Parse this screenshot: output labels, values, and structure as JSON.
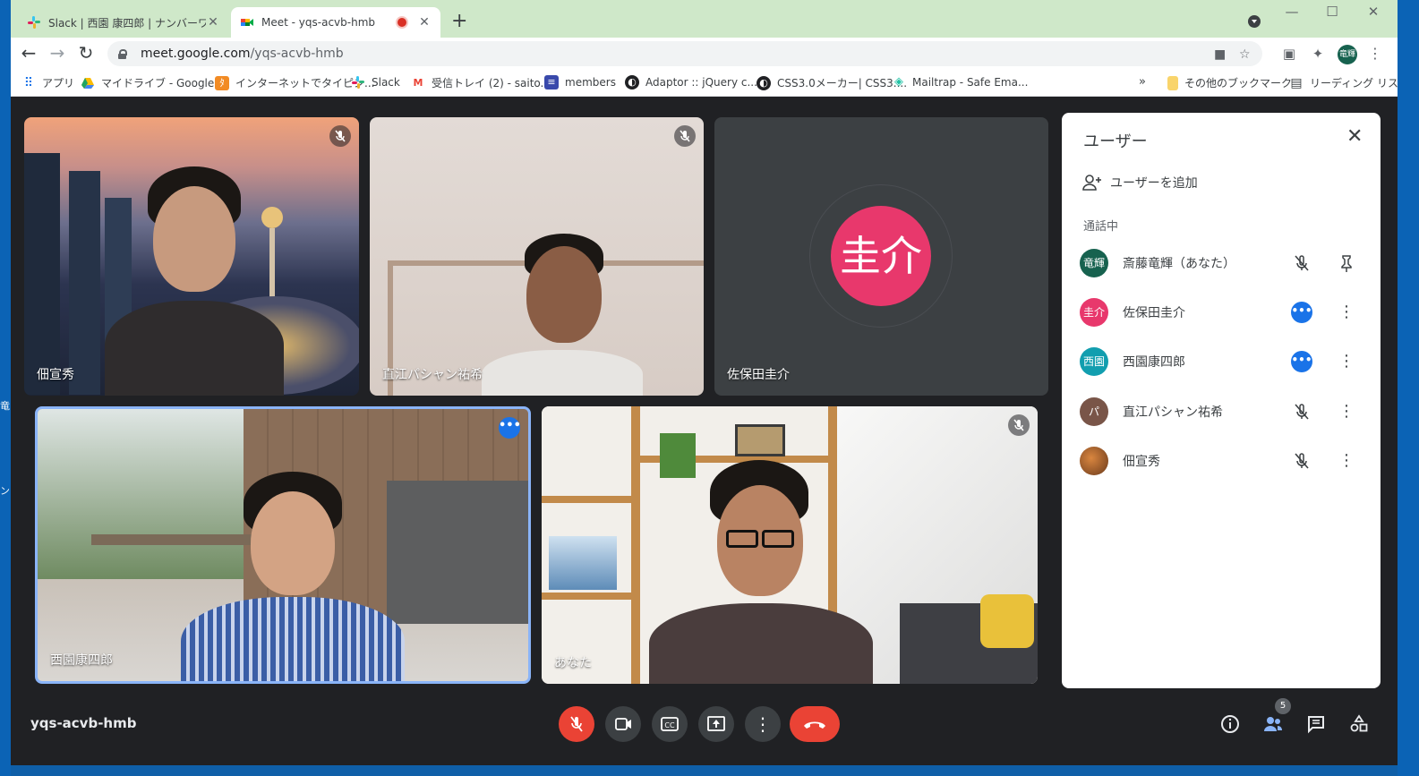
{
  "desktop": {
    "chars": [
      "竜",
      "ン"
    ]
  },
  "browser": {
    "tabs": [
      {
        "title": "Slack | 西園 康四郎 | ナンバーワンソ",
        "active": false
      },
      {
        "title": "Meet - yqs-acvb-hmb",
        "active": true
      }
    ],
    "new_tab": "+",
    "url_host": "meet.google.com",
    "url_path": "/yqs-acvb-hmb",
    "profile_initials": "竜輝",
    "bookmarks": [
      {
        "label": "アプリ",
        "icon": "apps-grid-icon"
      },
      {
        "label": "マイドライブ - Google...",
        "icon": "drive-icon"
      },
      {
        "label": "インターネットでタイピン...",
        "icon": "typing-icon"
      },
      {
        "label": "Slack",
        "icon": "slack-icon"
      },
      {
        "label": "受信トレイ (2) - saito...",
        "icon": "gmail-icon"
      },
      {
        "label": "members",
        "icon": "members-icon"
      },
      {
        "label": "Adaptor :: jQuery c...",
        "icon": "globe-icon"
      },
      {
        "label": "CSS3.0メーカー| CSS3....",
        "icon": "globe-icon"
      },
      {
        "label": "Mailtrap - Safe Ema...",
        "icon": "mailtrap-icon"
      }
    ],
    "bookmarks_more": "»",
    "other_bookmarks": "その他のブックマーク",
    "reading_list": "リーディング リスト"
  },
  "meet": {
    "tiles": [
      {
        "name": "佃宣秀",
        "status": "muted"
      },
      {
        "name": "直江パシャン祐希",
        "status": "muted"
      },
      {
        "name": "佐保田圭介",
        "status": "none",
        "avatar": "圭介"
      },
      {
        "name": "西園康四郎",
        "status": "speaking"
      },
      {
        "name": "あなた",
        "status": "muted"
      }
    ],
    "meeting_code": "yqs-acvb-hmb",
    "participant_count": "5",
    "panel": {
      "title": "ユーザー",
      "add_user": "ユーザーを追加",
      "section": "通話中",
      "participants": [
        {
          "name": "斎藤竜輝（あなた）",
          "avatar": "竜輝",
          "color": "#17624f",
          "mic": "muted",
          "action": "pin"
        },
        {
          "name": "佐保田圭介",
          "avatar": "圭介",
          "color": "#e8386c",
          "mic": "active",
          "action": "more"
        },
        {
          "name": "西園康四郎",
          "avatar": "西園",
          "color": "#129eaf",
          "mic": "active",
          "action": "more"
        },
        {
          "name": "直江パシャン祐希",
          "avatar": "パ",
          "color": "#795548",
          "mic": "muted",
          "action": "more"
        },
        {
          "name": "佃宣秀",
          "avatar": "",
          "color": "#8d5a2b",
          "mic": "muted",
          "action": "more"
        }
      ]
    }
  }
}
